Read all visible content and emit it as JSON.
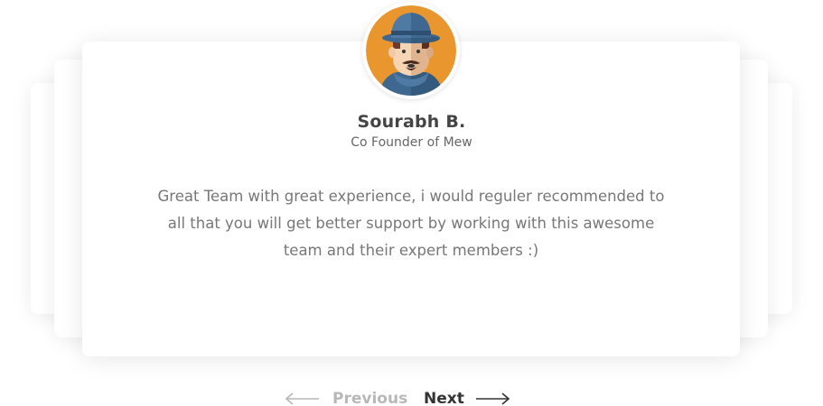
{
  "testimonial": {
    "name": "Sourabh B.",
    "role": "Co Founder of Mew",
    "quote": "Great Team with great experience, i would reguler recommended to all that you will get better support by working with this awesome team and their expert members :)",
    "avatar_icon": "man-with-hat-avatar-icon"
  },
  "navigation": {
    "previous_label": "Previous",
    "next_label": "Next",
    "previous_icon": "arrow-left-icon",
    "next_icon": "arrow-right-icon"
  },
  "colors": {
    "avatar_bg": "#E9962E",
    "previous_text": "#B8B8B8",
    "next_text": "#333333",
    "name_text": "#444444"
  }
}
